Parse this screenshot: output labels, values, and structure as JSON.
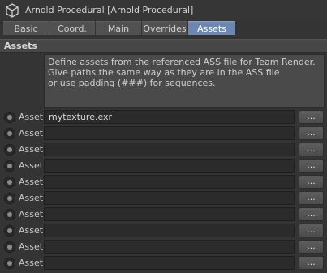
{
  "window": {
    "title": "Arnold Procedural [Arnold Procedural]",
    "icon": "procedural-cube-icon"
  },
  "tabs": [
    {
      "label": "Basic"
    },
    {
      "label": "Coord."
    },
    {
      "label": "Main"
    },
    {
      "label": "Overrides"
    },
    {
      "label": "Assets",
      "active": true
    }
  ],
  "section": {
    "title": "Assets"
  },
  "description": {
    "lines": [
      "Define assets from the referenced ASS file for Team Render.",
      "Give paths the same way as they are in the ASS file",
      "or use padding (###) for sequences."
    ]
  },
  "assets": {
    "label": "Asset",
    "browse_label": "...",
    "rows": [
      {
        "value": "mytexture.exr"
      },
      {
        "value": ""
      },
      {
        "value": ""
      },
      {
        "value": ""
      },
      {
        "value": ""
      },
      {
        "value": ""
      },
      {
        "value": ""
      },
      {
        "value": ""
      },
      {
        "value": ""
      },
      {
        "value": ""
      }
    ]
  },
  "colors": {
    "active_tab": "#6d86b3",
    "background": "#343434",
    "field": "#2b2b2b"
  }
}
